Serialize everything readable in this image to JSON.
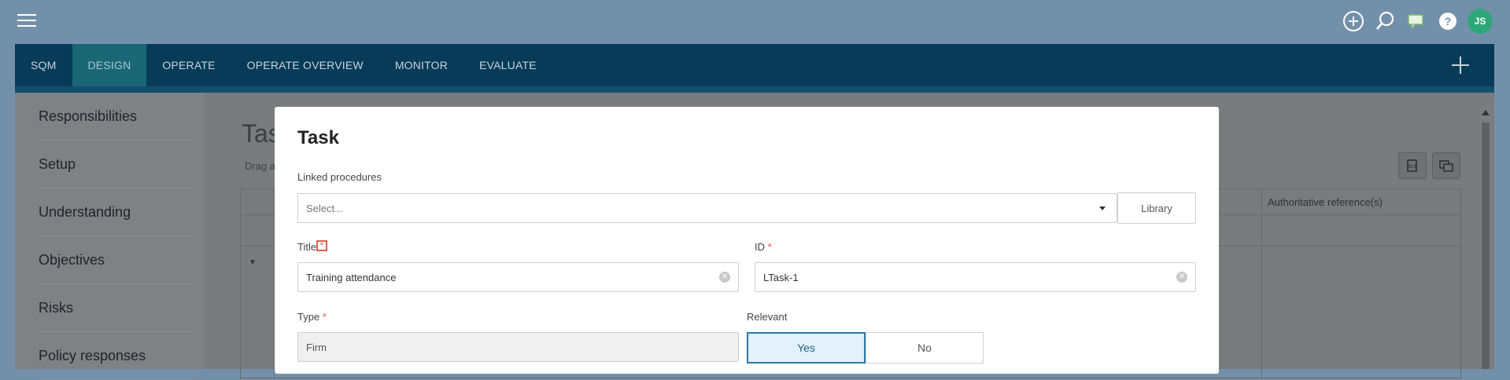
{
  "topbar": {
    "avatar_initials": "JS",
    "icons": [
      "plus-circle-icon",
      "search-icon",
      "chat-icon",
      "help-icon"
    ]
  },
  "nav": {
    "tabs": [
      {
        "label": "SQM",
        "active": false
      },
      {
        "label": "DESIGN",
        "active": true
      },
      {
        "label": "OPERATE",
        "active": false
      },
      {
        "label": "OPERATE OVERVIEW",
        "active": false
      },
      {
        "label": "MONITOR",
        "active": false
      },
      {
        "label": "EVALUATE",
        "active": false
      }
    ]
  },
  "sidebar": {
    "items": [
      {
        "label": "Responsibilities"
      },
      {
        "label": "Setup"
      },
      {
        "label": "Understanding"
      },
      {
        "label": "Objectives"
      },
      {
        "label": "Risks"
      },
      {
        "label": "Policy responses"
      }
    ]
  },
  "background": {
    "page_title": "Tas",
    "subtitle": "Drag a",
    "table_header_right": "Authoritative reference(s)"
  },
  "modal": {
    "title": "Task",
    "linked_procedures": {
      "label": "Linked procedures",
      "placeholder": "Select...",
      "library_button": "Library"
    },
    "title_field": {
      "label": "Title",
      "required_mark": "*",
      "value": "Training attendance"
    },
    "id_field": {
      "label": "ID",
      "required_mark": "*",
      "value": "LTask-1"
    },
    "type_field": {
      "label": "Type",
      "required_mark": "*",
      "value": "Firm"
    },
    "relevant": {
      "label": "Relevant",
      "yes_label": "Yes",
      "no_label": "No",
      "selected": "Yes"
    }
  },
  "colors": {
    "accent": "#2c79a6",
    "nav_bg": "#073b57",
    "nav_active": "#1a6775",
    "required": "#d9534f",
    "avatar_bg": "#2fa67a"
  }
}
